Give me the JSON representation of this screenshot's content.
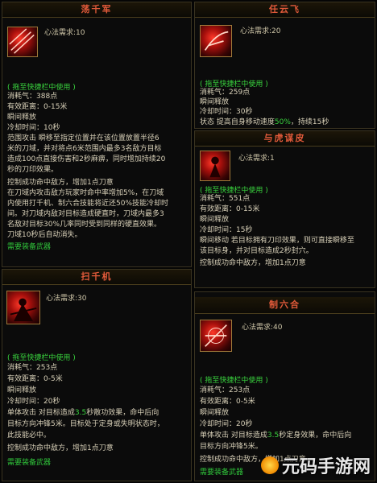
{
  "panels": {
    "p1": {
      "title": "荡千军",
      "req": "心法需求:10",
      "tag": "( 拖至快捷栏中使用 )",
      "lines": [
        "消耗气：388点",
        "有效距离：0-15米",
        "瞬间释放",
        "冷却时间：10秒",
        "范围攻击  瞬移至指定位置并在该位置放置半径6",
        "米的刀域，并对将点6米范围内最多3名敌方目标",
        "造成100点直接伤害和2秒麻痹，同时增加持续20",
        "秒的刀印效果。",
        "控制成功命中敌方，增加1点刀意",
        "在刀域内攻击敌方玩家时命中率增加5%，在刀域",
        "内使用打千机、制六合技能将近还50%技能冷却时",
        "间。对刀域内敌对目标造成硬直时，刀域内最多3",
        "名敌对目标30%几率同时受到同样的硬直效果。",
        "刀域10秒后自动消失。",
        "需要装备武器"
      ]
    },
    "p2": {
      "title": "任云飞",
      "req": "心法需求:20",
      "tag": "( 拖至快捷栏中使用 )",
      "lines": [
        "消耗气：259点",
        "瞬间释放",
        "冷却时间：30秒",
        "状态  提高自身移动速度50%，持续15秒"
      ]
    },
    "p3": {
      "title": "与虎谋皮",
      "req": "心法需求:1",
      "tag": "( 拖至快捷栏中使用 )",
      "lines": [
        "消耗气：551点",
        "有效距离：0-15米",
        "瞬间释放",
        "冷却时间：15秒",
        "瞬间移动  若目标拥有刀印效果，则可直接瞬移至",
        "该目标身，并对目标造成2秒封穴。",
        "控制成功命中敌方，增加1点刀意"
      ]
    },
    "p4": {
      "title": "扫千机",
      "req": "心法需求:30",
      "tag": "( 拖至快捷栏中使用 )",
      "lines": [
        "消耗气：253点",
        "有效距离：0-5米",
        "瞬间释放",
        "冷却时间：20秒",
        "单体攻击  对目标造成3.5秒散功效果，命中后向",
        "目标方向冲锋5米。目标处于定身或失明状态时，",
        "此技能必中。",
        "控制成功命中敌方，增加1点刀意",
        "需要装备武器"
      ]
    },
    "p5": {
      "title": "制六合",
      "req": "心法需求:40",
      "tag": "( 拖至快捷栏中使用 )",
      "lines": [
        "消耗气：253点",
        "有效距离：0-5米",
        "瞬间释放",
        "冷却时间：20秒",
        "单体攻击  对目标造成3.5秒定身效果，命中后向",
        "目标方向冲锋5米。",
        "控制成功命中敌方，增加1点刀意",
        "需要装备武器"
      ]
    }
  },
  "watermark": "元码手游网",
  "colors": {
    "title": "#e25a3a",
    "highlight": "#39d43e",
    "border": "#3a3320"
  }
}
